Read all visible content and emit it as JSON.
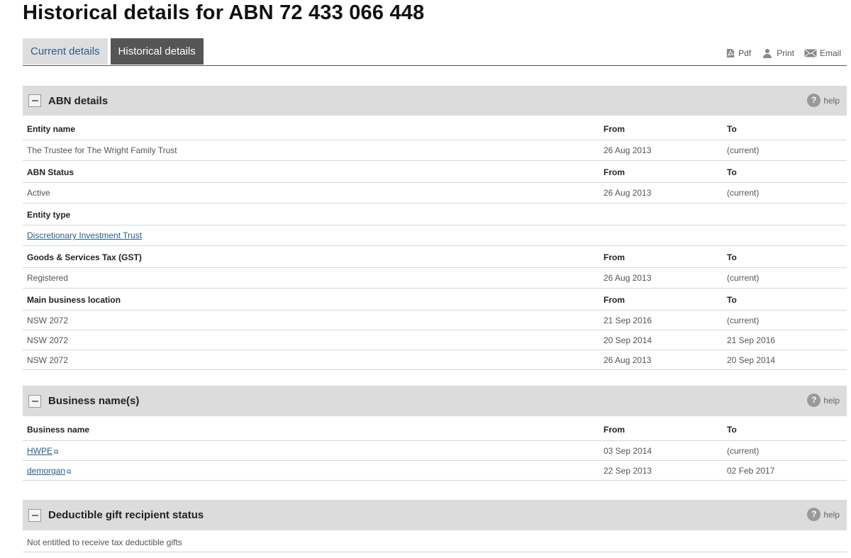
{
  "page": {
    "title": "Historical details for ABN 72 433 066 448"
  },
  "tabs": [
    {
      "label": "Current details"
    },
    {
      "label": "Historical details"
    }
  ],
  "tools": {
    "pdf": "Pdf",
    "print": "Print",
    "email": "Email"
  },
  "help_label": "help",
  "abn_details": {
    "title": "ABN details",
    "entity_name": {
      "header": "Entity name",
      "from": "From",
      "to": "To",
      "value": "The Trustee for The Wright Family Trust",
      "value_from": "26 Aug 2013",
      "value_to": "(current)"
    },
    "abn_status": {
      "header": "ABN Status",
      "from": "From",
      "to": "To",
      "value": "Active",
      "value_from": "26 Aug 2013",
      "value_to": "(current)"
    },
    "entity_type": {
      "header": "Entity type",
      "value": "Discretionary Investment Trust"
    },
    "gst": {
      "header": "Goods & Services Tax (GST)",
      "from": "From",
      "to": "To",
      "value": "Registered",
      "value_from": "26 Aug 2013",
      "value_to": "(current)"
    },
    "location": {
      "header": "Main business location",
      "from": "From",
      "to": "To",
      "rows": [
        {
          "value": "NSW 2072",
          "from": "21 Sep 2016",
          "to": "(current)"
        },
        {
          "value": "NSW 2072",
          "from": "20 Sep 2014",
          "to": "21 Sep 2016"
        },
        {
          "value": "NSW 2072",
          "from": "26 Aug 2013",
          "to": "20 Sep 2014"
        }
      ]
    }
  },
  "business_names": {
    "title": "Business name(s)",
    "header": "Business name",
    "from": "From",
    "to": "To",
    "rows": [
      {
        "name": "HWPE",
        "from": "03 Sep 2014",
        "to": "(current)"
      },
      {
        "name": "demorgan",
        "from": "22 Sep 2013",
        "to": "02 Feb 2017"
      }
    ]
  },
  "dgr": {
    "title": "Deductible gift recipient status",
    "value": "Not entitled to receive tax deductible gifts"
  }
}
